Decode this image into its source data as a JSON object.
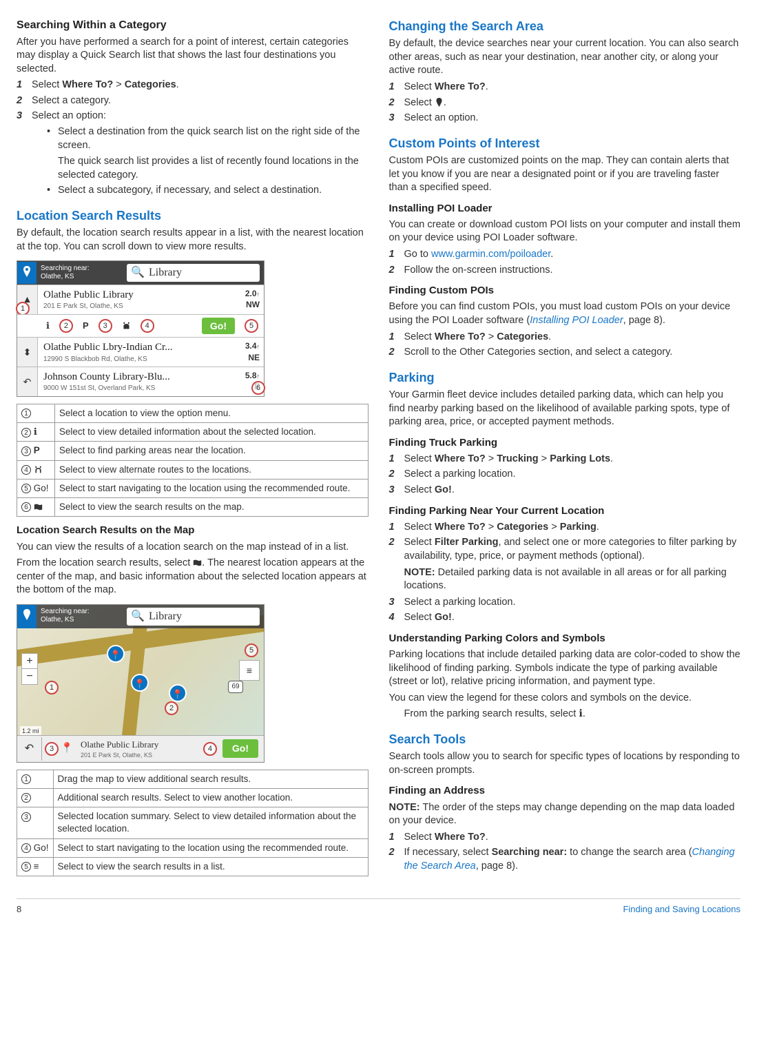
{
  "left": {
    "sec1": {
      "title": "Searching Within a Category",
      "intro": "After you have performed a search for a point of interest, certain categories may display a Quick Search list that shows the last four destinations you selected.",
      "s1a": "Select ",
      "s1b": "Where To?",
      "s1c": " > ",
      "s1d": "Categories",
      "s1e": ".",
      "s2": "Select a category.",
      "s3": "Select an option:",
      "b1": "Select a destination from the quick search list on the right side of the screen.",
      "b1n": "The quick search list provides a list of recently found locations in the selected category.",
      "b2": "Select a subcategory, if necessary, and select a destination."
    },
    "sec2": {
      "title": "Location Search Results",
      "intro": "By default, the location search results appear in a list, with the nearest location at the top. You can scroll down to view more results."
    },
    "fig1": {
      "near_label": "Searching near:",
      "near_place": "Olathe, KS",
      "search": "Library",
      "r1_name": "Olathe Public Library",
      "r1_addr": "201 E Park St, Olathe, KS",
      "r1_dist": "2.0",
      "r1_dir": "NW",
      "r2_name": "Olathe Public Lbry-Indian Cr...",
      "r2_addr": "12990 S Blackbob Rd, Olathe, KS",
      "r2_dist": "3.4",
      "r2_dir": "NE",
      "r3_name": "Johnson County Library-Blu...",
      "r3_addr": "9000 W 151st St, Overland Park, KS",
      "r3_dist": "5.8",
      "r3_dir": "E",
      "go": "Go!"
    },
    "table1": {
      "r1": "Select a location to view the option menu.",
      "r2": "Select to view detailed information about the selected location.",
      "r3": "Select to find parking areas near the location.",
      "r4": "Select to view alternate routes to the locations.",
      "r5": "Select to start navigating to the location using the recommended route.",
      "r6": "Select to view the search results on the map.",
      "go": "Go!"
    },
    "sec3": {
      "title": "Location Search Results on the Map",
      "p1": "You can view the results of a location search on the map instead of in a list.",
      "p2a": "From the location search results, select ",
      "p2b": ". The nearest location appears at the center of the map, and basic information about the selected location appears at the bottom of the map."
    },
    "fig2": {
      "near_label": "Searching near:",
      "near_place": "Olathe, KS",
      "search": "Library",
      "scale": "1.2 mi",
      "shield": "69",
      "title": "Olathe Public Library",
      "addr": "201 E Park St, Olathe, KS",
      "go": "Go!"
    },
    "table2": {
      "r1": "Drag the map to view additional search results.",
      "r2": "Additional search results. Select to view another location.",
      "r3": "Selected location summary. Select to view detailed information about the selected location.",
      "r4": "Select to start navigating to the location using the recommended route.",
      "r5": "Select to view the search results in a list.",
      "go": "Go!"
    }
  },
  "right": {
    "sec1": {
      "title": "Changing the Search Area",
      "intro": "By default, the device searches near your current location. You can also search other areas, such as near your destination, near another city, or along your active route.",
      "s1a": "Select ",
      "s1b": "Where To?",
      "s1c": ".",
      "s2a": "Select ",
      "s2b": ".",
      "s3": "Select an option."
    },
    "sec2": {
      "title": "Custom Points of Interest",
      "intro": "Custom POIs are customized points on the map. They can contain alerts that let you know if you are near a designated point or if you are traveling faster than a specified speed."
    },
    "sec2a": {
      "title": "Installing POI Loader",
      "intro": "You can create or download custom POI lists on your computer and install them on your device using POI Loader software.",
      "s1a": "Go to ",
      "s1b": "www.garmin.com/poiloader",
      "s1c": ".",
      "s2": "Follow the on-screen instructions."
    },
    "sec2b": {
      "title": "Finding Custom POIs",
      "p1a": "Before you can find custom POIs, you must load custom POIs on your device using the POI Loader software (",
      "p1b": "Installing POI Loader",
      "p1c": ", page 8).",
      "s1a": "Select ",
      "s1b": "Where To?",
      "s1c": " > ",
      "s1d": "Categories",
      "s1e": ".",
      "s2": "Scroll to the Other Categories section, and select a category."
    },
    "sec3": {
      "title": "Parking",
      "intro": "Your Garmin fleet device includes detailed parking data, which can help you find nearby parking based on the likelihood of available parking spots, type of parking area, price, or accepted payment methods."
    },
    "sec3a": {
      "title": "Finding Truck Parking",
      "s1a": "Select ",
      "s1b": "Where To?",
      "s1c": " > ",
      "s1d": "Trucking",
      "s1e": " > ",
      "s1f": "Parking Lots",
      "s1g": ".",
      "s2": "Select a parking location.",
      "s3a": "Select ",
      "s3b": "Go!",
      "s3c": "."
    },
    "sec3b": {
      "title": "Finding Parking Near Your Current Location",
      "s1a": "Select ",
      "s1b": "Where To?",
      "s1c": " > ",
      "s1d": "Categories",
      "s1e": " > ",
      "s1f": "Parking",
      "s1g": ".",
      "s2a": "Select ",
      "s2b": "Filter Parking",
      "s2c": ", and select one or more categories to filter parking by availability, type, price, or payment methods (optional).",
      "s2n1": "NOTE:",
      "s2n2": " Detailed parking data is not available in all areas or for all parking locations.",
      "s3": "Select a parking location.",
      "s4a": "Select ",
      "s4b": "Go!",
      "s4c": "."
    },
    "sec3c": {
      "title": "Understanding Parking Colors and Symbols",
      "p1": "Parking locations that include detailed parking data are color-coded to show the likelihood of finding parking. Symbols indicate the type of parking available (street or lot), relative pricing information, and payment type.",
      "p2": "You can view the legend for these colors and symbols on the device.",
      "p3a": "From the parking search results, select ",
      "p3b": "."
    },
    "sec4": {
      "title": "Search Tools",
      "intro": "Search tools allow you to search for specific types of locations by responding to on-screen prompts."
    },
    "sec4a": {
      "title": "Finding an Address",
      "n1": "NOTE:",
      "n2": " The order of the steps may change depending on the map data loaded on your device.",
      "s1a": "Select ",
      "s1b": "Where To?",
      "s1c": ".",
      "s2a": "If necessary, select ",
      "s2b": "Searching near:",
      "s2c": " to change the search area (",
      "s2d": "Changing the Search Area",
      "s2e": ", page 8)."
    }
  },
  "footer": {
    "page": "8",
    "section": "Finding and Saving Locations"
  }
}
